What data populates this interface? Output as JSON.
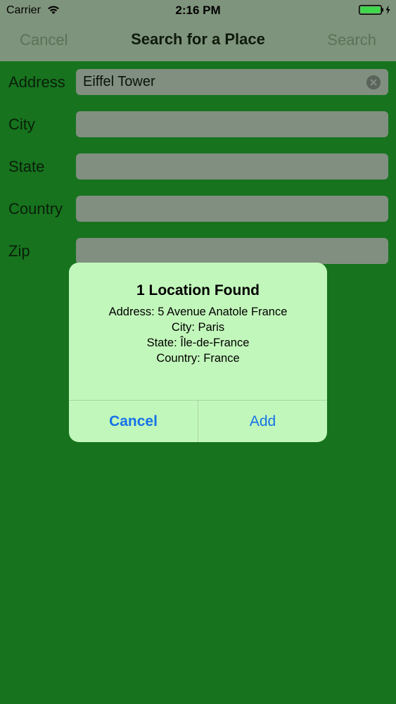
{
  "status_bar": {
    "carrier": "Carrier",
    "time": "2:16 PM",
    "wifi_icon": "wifi-icon",
    "battery_icon": "battery-charging-icon",
    "battery_color": "#3ed94b"
  },
  "nav": {
    "cancel_label": "Cancel",
    "title": "Search for a Place",
    "search_label": "Search"
  },
  "form": {
    "fields": [
      {
        "label": "Address",
        "value": "Eiffel Tower"
      },
      {
        "label": "City",
        "value": ""
      },
      {
        "label": "State",
        "value": ""
      },
      {
        "label": "Country",
        "value": ""
      },
      {
        "label": "Zip",
        "value": ""
      }
    ],
    "clear_icon": "clear-circle-icon"
  },
  "alert": {
    "title": "1 Location Found",
    "message_lines": [
      "Address: 5 Avenue Anatole France",
      "City: Paris",
      "State: Île-de-France",
      "Country: France"
    ],
    "cancel_label": "Cancel",
    "add_label": "Add"
  },
  "colors": {
    "background": "#17731e",
    "nav_background": "#7f947c",
    "alert_background": "#c2f7bb",
    "accent": "#1573e8"
  }
}
